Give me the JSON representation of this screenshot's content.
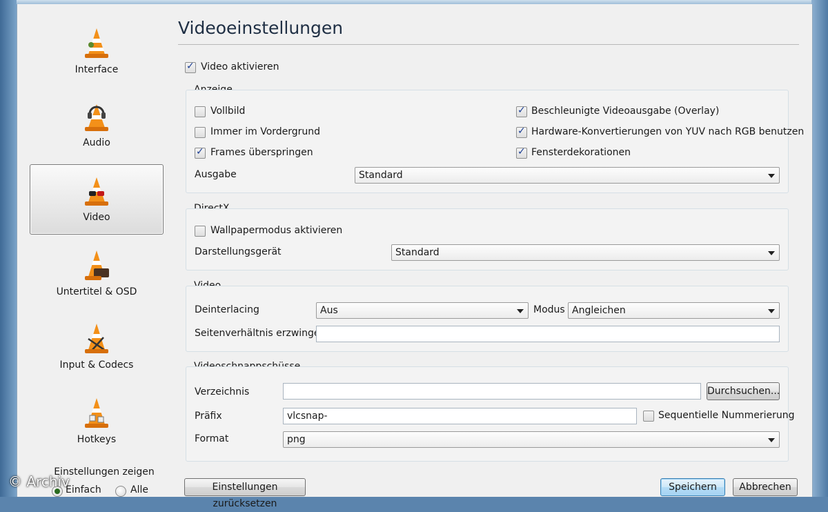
{
  "sidebar": {
    "items": [
      {
        "label": "Interface",
        "icon": "vlc-cone-icon"
      },
      {
        "label": "Audio",
        "icon": "headphones-cone-icon"
      },
      {
        "label": "Video",
        "icon": "glasses-cone-icon"
      },
      {
        "label": "Untertitel & OSD",
        "icon": "subtitle-cone-icon"
      },
      {
        "label": "Input & Codecs",
        "icon": "codec-cone-icon"
      },
      {
        "label": "Hotkeys",
        "icon": "hotkeys-cone-icon"
      }
    ],
    "selected": "Video",
    "show_settings": {
      "title": "Einstellungen zeigen",
      "simple_label": "Einfach",
      "all_label": "Alle",
      "selected": "Einfach"
    }
  },
  "page": {
    "title": "Videoeinstellungen",
    "enable_video_label": "Video aktivieren",
    "enable_video_checked": true
  },
  "anzeige": {
    "title": "Anzeige",
    "fullscreen_label": "Vollbild",
    "fullscreen_checked": false,
    "always_on_top_label": "Immer im Vordergrund",
    "always_on_top_checked": false,
    "skip_frames_label": "Frames überspringen",
    "skip_frames_checked": true,
    "overlay_label": "Beschleunigte Videoausgabe (Overlay)",
    "overlay_checked": true,
    "yuv_rgb_label": "Hardware-Konvertierungen von YUV nach RGB benutzen",
    "yuv_rgb_checked": true,
    "decorations_label": "Fensterdekorationen",
    "decorations_checked": true,
    "output_label": "Ausgabe",
    "output_value": "Standard"
  },
  "directx": {
    "title": "DirectX",
    "wallpaper_label": "Wallpapermodus aktivieren",
    "wallpaper_checked": false,
    "device_label": "Darstellungsgerät",
    "device_value": "Standard"
  },
  "video": {
    "title": "Video",
    "deinterlacing_label": "Deinterlacing",
    "deinterlacing_value": "Aus",
    "mode_label": "Modus",
    "mode_value": "Angleichen",
    "aspect_label": "Seitenverhältnis erzwingen",
    "aspect_value": ""
  },
  "snapshots": {
    "title": "Videoschnappschüsse",
    "directory_label": "Verzeichnis",
    "directory_value": "",
    "browse_label": "Durchsuchen...",
    "prefix_label": "Präfix",
    "prefix_value": "vlcsnap-",
    "sequential_label": "Sequentielle Nummerierung",
    "sequential_checked": false,
    "format_label": "Format",
    "format_value": "png"
  },
  "footer": {
    "reset_label": "Einstellungen zurücksetzen",
    "save_label": "Speichern",
    "cancel_label": "Abbrechen"
  },
  "watermark": "© Archiv"
}
